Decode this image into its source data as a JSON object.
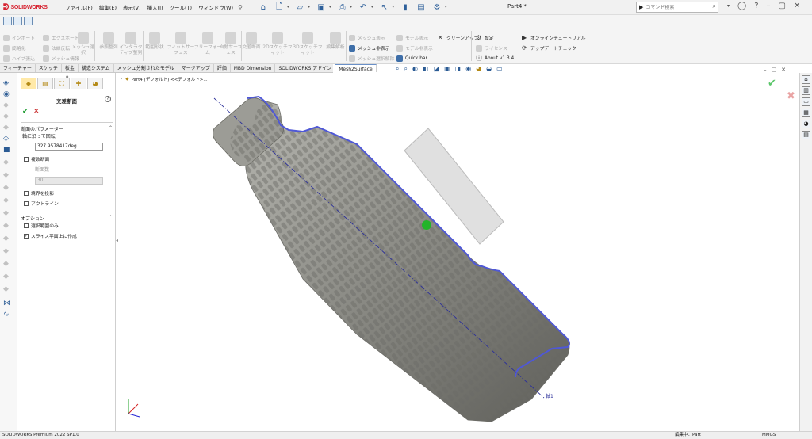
{
  "app": {
    "name": "SOLIDWORKS",
    "document_title": "Part4 *"
  },
  "menu": [
    "ファイル(F)",
    "編集(E)",
    "表示(V)",
    "挿入(I)",
    "ツール(T)",
    "ウィンドウ(W)"
  ],
  "search": {
    "placeholder": "コマンド検索"
  },
  "command_manager": {
    "group1": [
      "インポート",
      "簡略化",
      "ハイブ張込"
    ],
    "group1b": [
      "エクスポート",
      "法線反転",
      "メッシュ情報"
    ],
    "group1c": "メッシュ選択",
    "group2": [
      "参照整列",
      "インタラクティブ整列"
    ],
    "group3": [
      "範囲形状",
      "フィットサーフェス",
      "フリーフォーム",
      "自動サーフェス"
    ],
    "group4": [
      "交差断面",
      "2Dスケッチフィット",
      "3Dスケッチフィット"
    ],
    "group5": "編集解析",
    "group6": [
      "メッシュ表示",
      "メッシュ非表示",
      "メッシュ選択解除"
    ],
    "group7": [
      "モデル表示",
      "モデル非表示",
      "Quick bar"
    ],
    "group8": [
      "クリーンアップ"
    ],
    "group9": [
      "設定",
      "ライセンス",
      "About v1.3.4"
    ],
    "group10": [
      "オンラインチュートリアル",
      "アップデートチェック"
    ]
  },
  "tabs": [
    "フィーチャー",
    "スケッチ",
    "板金",
    "構造システム",
    "メッシュ分割されたモデル",
    "マークアップ",
    "評価",
    "MBD Dimension",
    "SOLIDWORKS アドイン",
    "Mesh2Surface"
  ],
  "active_tab": "Mesh2Surface",
  "breadcrumb": "Part4 (デフォルト) <<デフォルト>...",
  "property_manager": {
    "title": "交差断面",
    "section_params": "断面のパラメーター",
    "rotate_label": "軸に沿って回転",
    "rotate_value": "327.9578417deg",
    "multi_section": "複数断面",
    "section_count_label": "断面数",
    "section_count_value": "30",
    "project_boundary": "境界を投影",
    "outline": "アウトライン",
    "section_options": "オプション",
    "selected_only": "選択範囲のみ",
    "create_on_plane": "スライス平面上に作成"
  },
  "viewport": {
    "axis_label": "軸1"
  },
  "status": {
    "version": "SOLIDWORKS Premium 2022 SP1.0",
    "editing": "編集中：Part",
    "units": "MMGS"
  },
  "colors": {
    "brand": "#d6212f",
    "section_curve": "#5058d8",
    "axis_line": "#2b2f9a",
    "accept": "#1c9b2f",
    "cancel": "#c62020",
    "model": "#8e8e87"
  }
}
